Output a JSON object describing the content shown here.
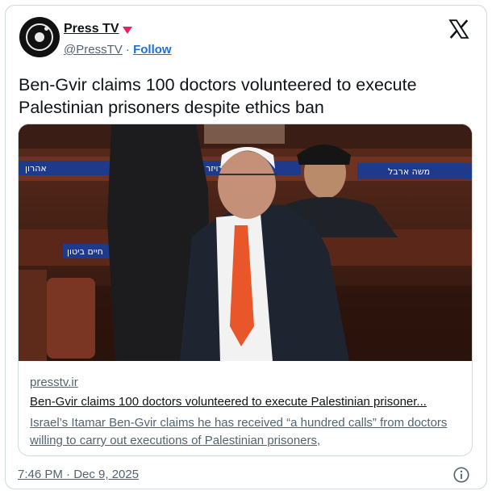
{
  "account": {
    "name": "Press TV",
    "handle": "@PressTV",
    "separator": "·",
    "follow_label": "Follow",
    "avatar_icon": "presstv-logo-avatar",
    "badge_icon": "red-triangle-badge"
  },
  "platform_icon": "x-logo-icon",
  "tweet": {
    "text": "Ben-Gvir claims 100 doctors volunteered to execute Palestinian prisoners despite ethics ban"
  },
  "link_card": {
    "domain": "presstv.ir",
    "title": "Ben-Gvir claims 100 doctors volunteered to execute Palestinian prisoner...",
    "description": "Israel’s Itamar Ben-Gvir claims he has received “a hundred calls” from doctors willing to carry out executions of Palestinian prisoners,",
    "image": {
      "nameplate_top_left": "אהרון",
      "nameplate_mid": "יצחק קרויזר",
      "nameplate_right": "משה ארבל",
      "nameplate_lower_left": "חיים ביטון"
    }
  },
  "footer": {
    "timestamp": "7:46 PM · Dec 9, 2025",
    "info_icon": "info-icon"
  },
  "colors": {
    "text": "#0f1419",
    "secondary": "#536471",
    "link": "#1d70d8",
    "border": "#cfd9de",
    "badge": "#e0245e",
    "tie": "#e8562a"
  }
}
